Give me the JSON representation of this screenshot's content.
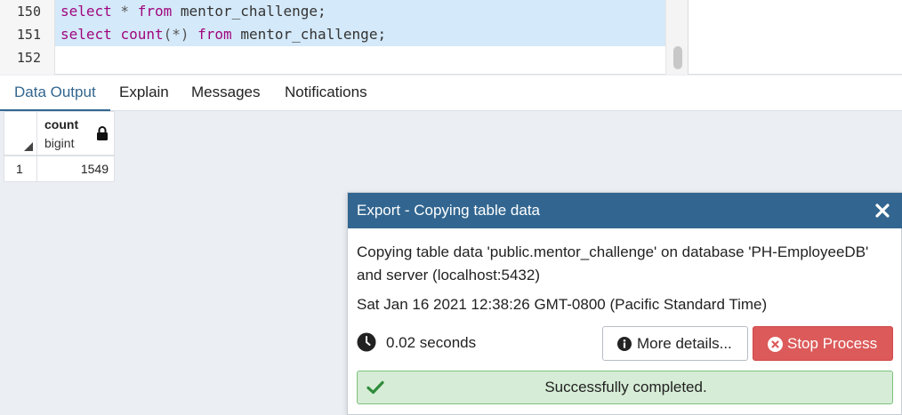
{
  "editor": {
    "line_numbers": [
      "150",
      "151",
      "152"
    ],
    "lines": [
      {
        "kw1": "select",
        "op": " * ",
        "kw2": "from",
        "rest": " mentor_challenge;"
      },
      {
        "kw1": "select",
        "fn": "count",
        "paren": "(*)",
        "kw2": "from",
        "rest": " mentor_challenge;"
      },
      {
        "text": ""
      }
    ]
  },
  "tabs": [
    {
      "label": "Data Output",
      "active": true
    },
    {
      "label": "Explain",
      "active": false
    },
    {
      "label": "Messages",
      "active": false
    },
    {
      "label": "Notifications",
      "active": false
    }
  ],
  "grid": {
    "columns": [
      {
        "name": "count",
        "type": "bigint",
        "icon": "lock-icon"
      }
    ],
    "rows": [
      {
        "num": "1",
        "values": [
          "1549"
        ]
      }
    ]
  },
  "dialog": {
    "title": "Export - Copying table data",
    "message": "Copying table data 'public.mentor_challenge' on database 'PH-EmployeeDB' and server (localhost:5432)",
    "timestamp": "Sat Jan 16 2021 12:38:26 GMT-0800 (Pacific Standard Time)",
    "elapsed": "0.02 seconds",
    "more_details_label": "More details...",
    "stop_label": "Stop Process",
    "status": "Successfully completed."
  },
  "colors": {
    "header_blue": "#326690",
    "keyword": "#a0067e",
    "selection": "#d4e9f9",
    "stop_red": "#dc5a5a",
    "success_bg": "#d6ecd6"
  }
}
